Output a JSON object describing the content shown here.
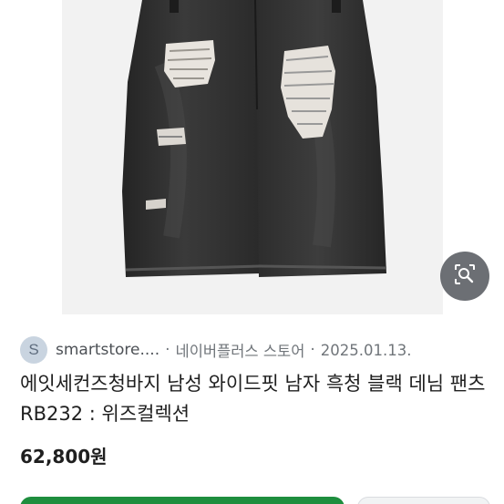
{
  "result": {
    "favicon_letter": "S",
    "site_name": "smartstore....",
    "separator": "·",
    "merchant": "네이버플러스 스토어",
    "date": "2025.01.13.",
    "title": "에잇세컨즈청바지 남성 와이드핏 남자 흑청 블랙 데님 팬츠 RB232 : 위즈컬렉션",
    "price": "62,800원"
  },
  "image": {
    "subject": "black distressed wide-leg denim jeans",
    "background_color": "#f2f2f2",
    "denim_color": "#2e2e2e"
  },
  "actions": {
    "lens_icon": "image-search-icon",
    "primary_color": "#1e8e3e"
  }
}
